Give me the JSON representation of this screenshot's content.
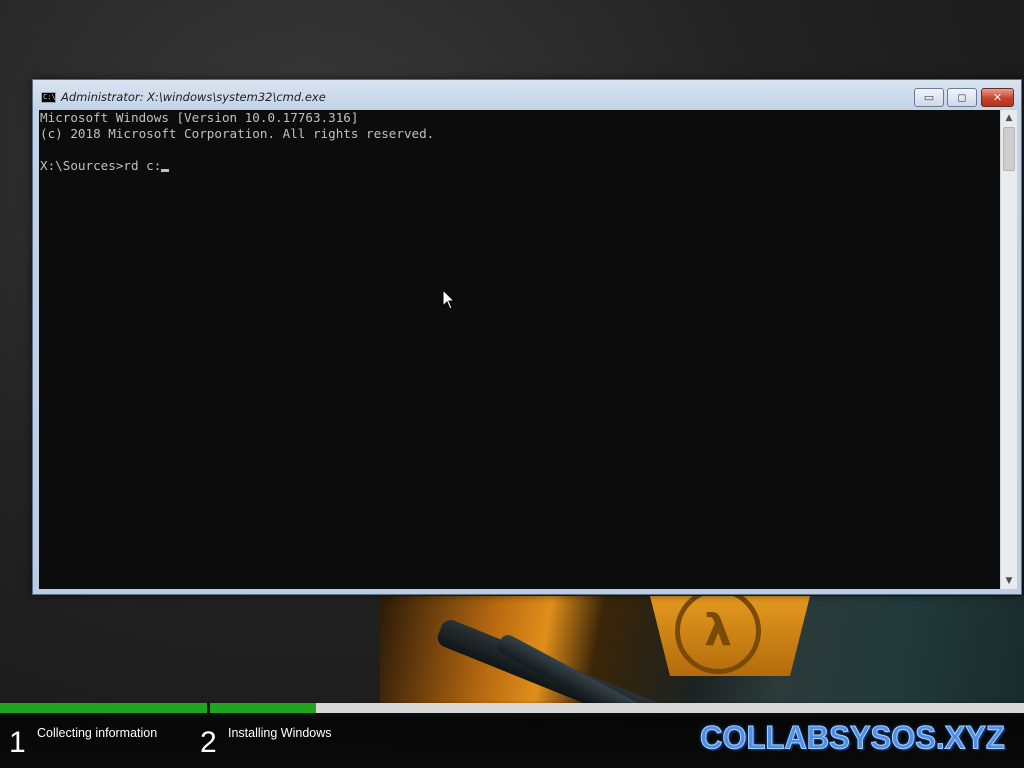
{
  "window": {
    "title": "Administrator: X:\\windows\\system32\\cmd.exe",
    "icon": "cmd-icon",
    "minimize_label": "▭",
    "maximize_label": "◻",
    "close_label": "✕"
  },
  "console": {
    "lines": [
      "Microsoft Windows [Version 10.0.17763.316]",
      "(c) 2018 Microsoft Corporation. All rights reserved.",
      "",
      "X:\\Sources>rd c:"
    ]
  },
  "setup": {
    "steps": [
      {
        "number": "1",
        "label": "Collecting information",
        "progress": 1.0
      },
      {
        "number": "2",
        "label": "Installing Windows",
        "progress": 0.13
      }
    ],
    "progress_color": "#1fa51f"
  },
  "brand": {
    "text": "COLLABSYSOS.XYZ",
    "color": "#4f8fe6"
  }
}
